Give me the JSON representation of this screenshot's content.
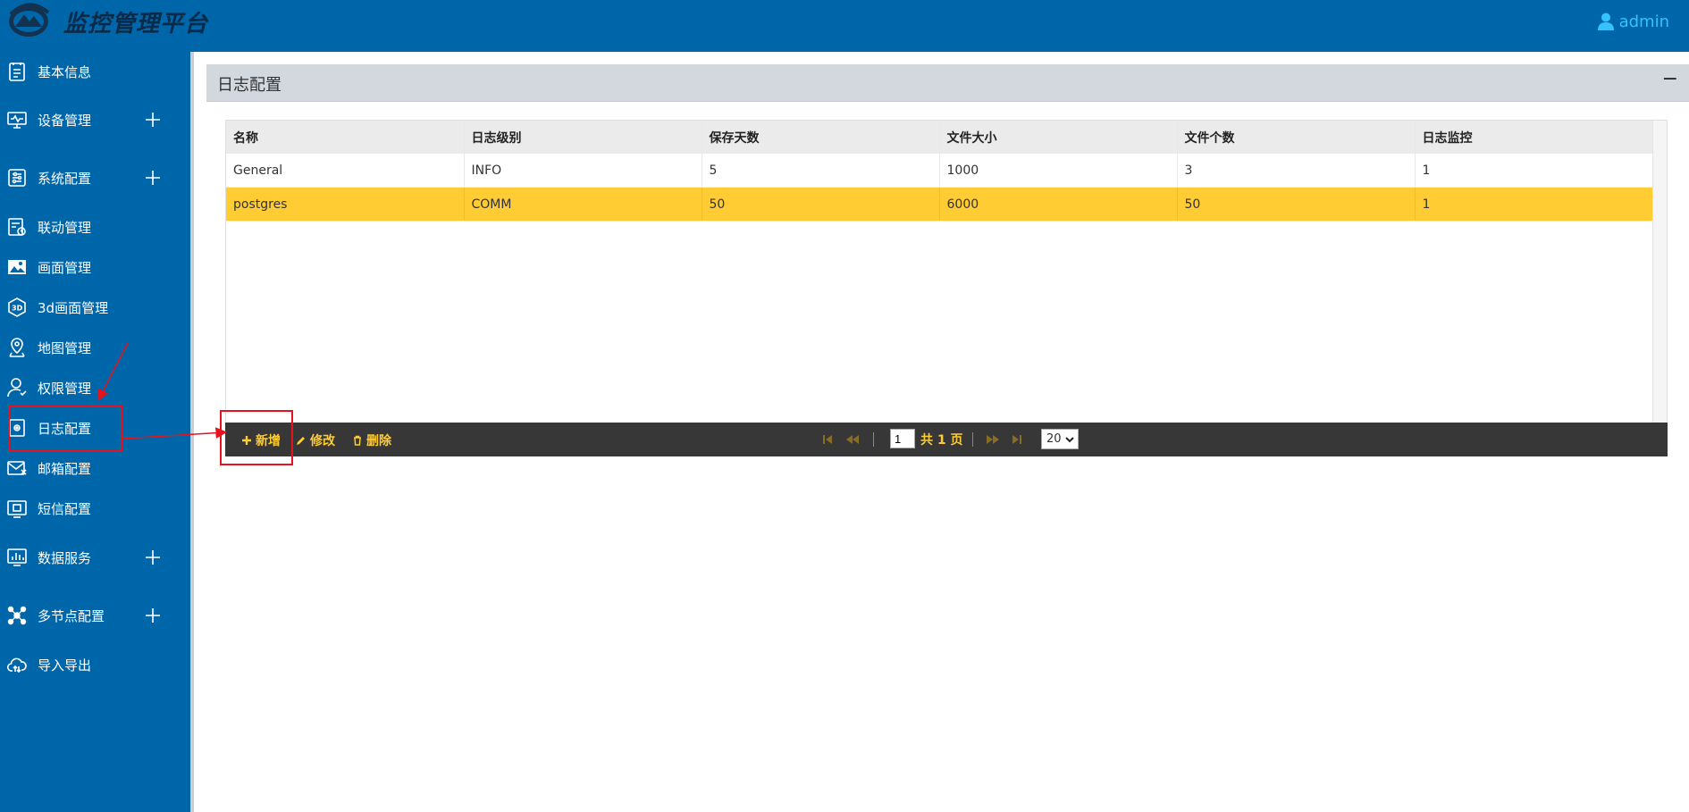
{
  "header": {
    "title": "监控管理平台",
    "user": "admin"
  },
  "sidebar": {
    "items": [
      {
        "label": "基本信息",
        "icon": "info-doc-icon"
      },
      {
        "label": "设备管理",
        "icon": "monitor-icon",
        "expandable": true
      },
      {
        "label": "系统配置",
        "icon": "settings-sliders-icon",
        "expandable": true
      },
      {
        "label": "联动管理",
        "icon": "linkage-icon"
      },
      {
        "label": "画面管理",
        "icon": "picture-icon"
      },
      {
        "label": "3d画面管理",
        "icon": "3d-icon"
      },
      {
        "label": "地图管理",
        "icon": "map-pin-icon"
      },
      {
        "label": "权限管理",
        "icon": "user-permission-icon"
      },
      {
        "label": "日志配置",
        "icon": "log-config-icon"
      },
      {
        "label": "邮箱配置",
        "icon": "mail-icon"
      },
      {
        "label": "短信配置",
        "icon": "sms-icon"
      },
      {
        "label": "数据服务",
        "icon": "chart-icon",
        "expandable": true
      },
      {
        "label": "多节点配置",
        "icon": "nodes-icon",
        "expandable": true
      },
      {
        "label": "导入导出",
        "icon": "cloud-sync-icon"
      }
    ]
  },
  "panel": {
    "title": "日志配置",
    "collapse_label": "−"
  },
  "table": {
    "columns": [
      "名称",
      "日志级别",
      "保存天数",
      "文件大小",
      "文件个数",
      "日志监控"
    ],
    "rows": [
      {
        "cells": [
          "General",
          "INFO",
          "5",
          "1000",
          "3",
          "1"
        ],
        "selected": false
      },
      {
        "cells": [
          "postgres",
          "COMM",
          "50",
          "6000",
          "50",
          "1"
        ],
        "selected": true
      }
    ]
  },
  "toolbar": {
    "add_label": "新增",
    "edit_label": "修改",
    "delete_label": "删除"
  },
  "pager": {
    "page": "1",
    "total_text": "共 1 页",
    "page_size": "20"
  },
  "colors": {
    "primary": "#0066aa",
    "accent": "#ffcc33",
    "toolbar_bg": "#373737",
    "annotation": "#e5141c"
  }
}
